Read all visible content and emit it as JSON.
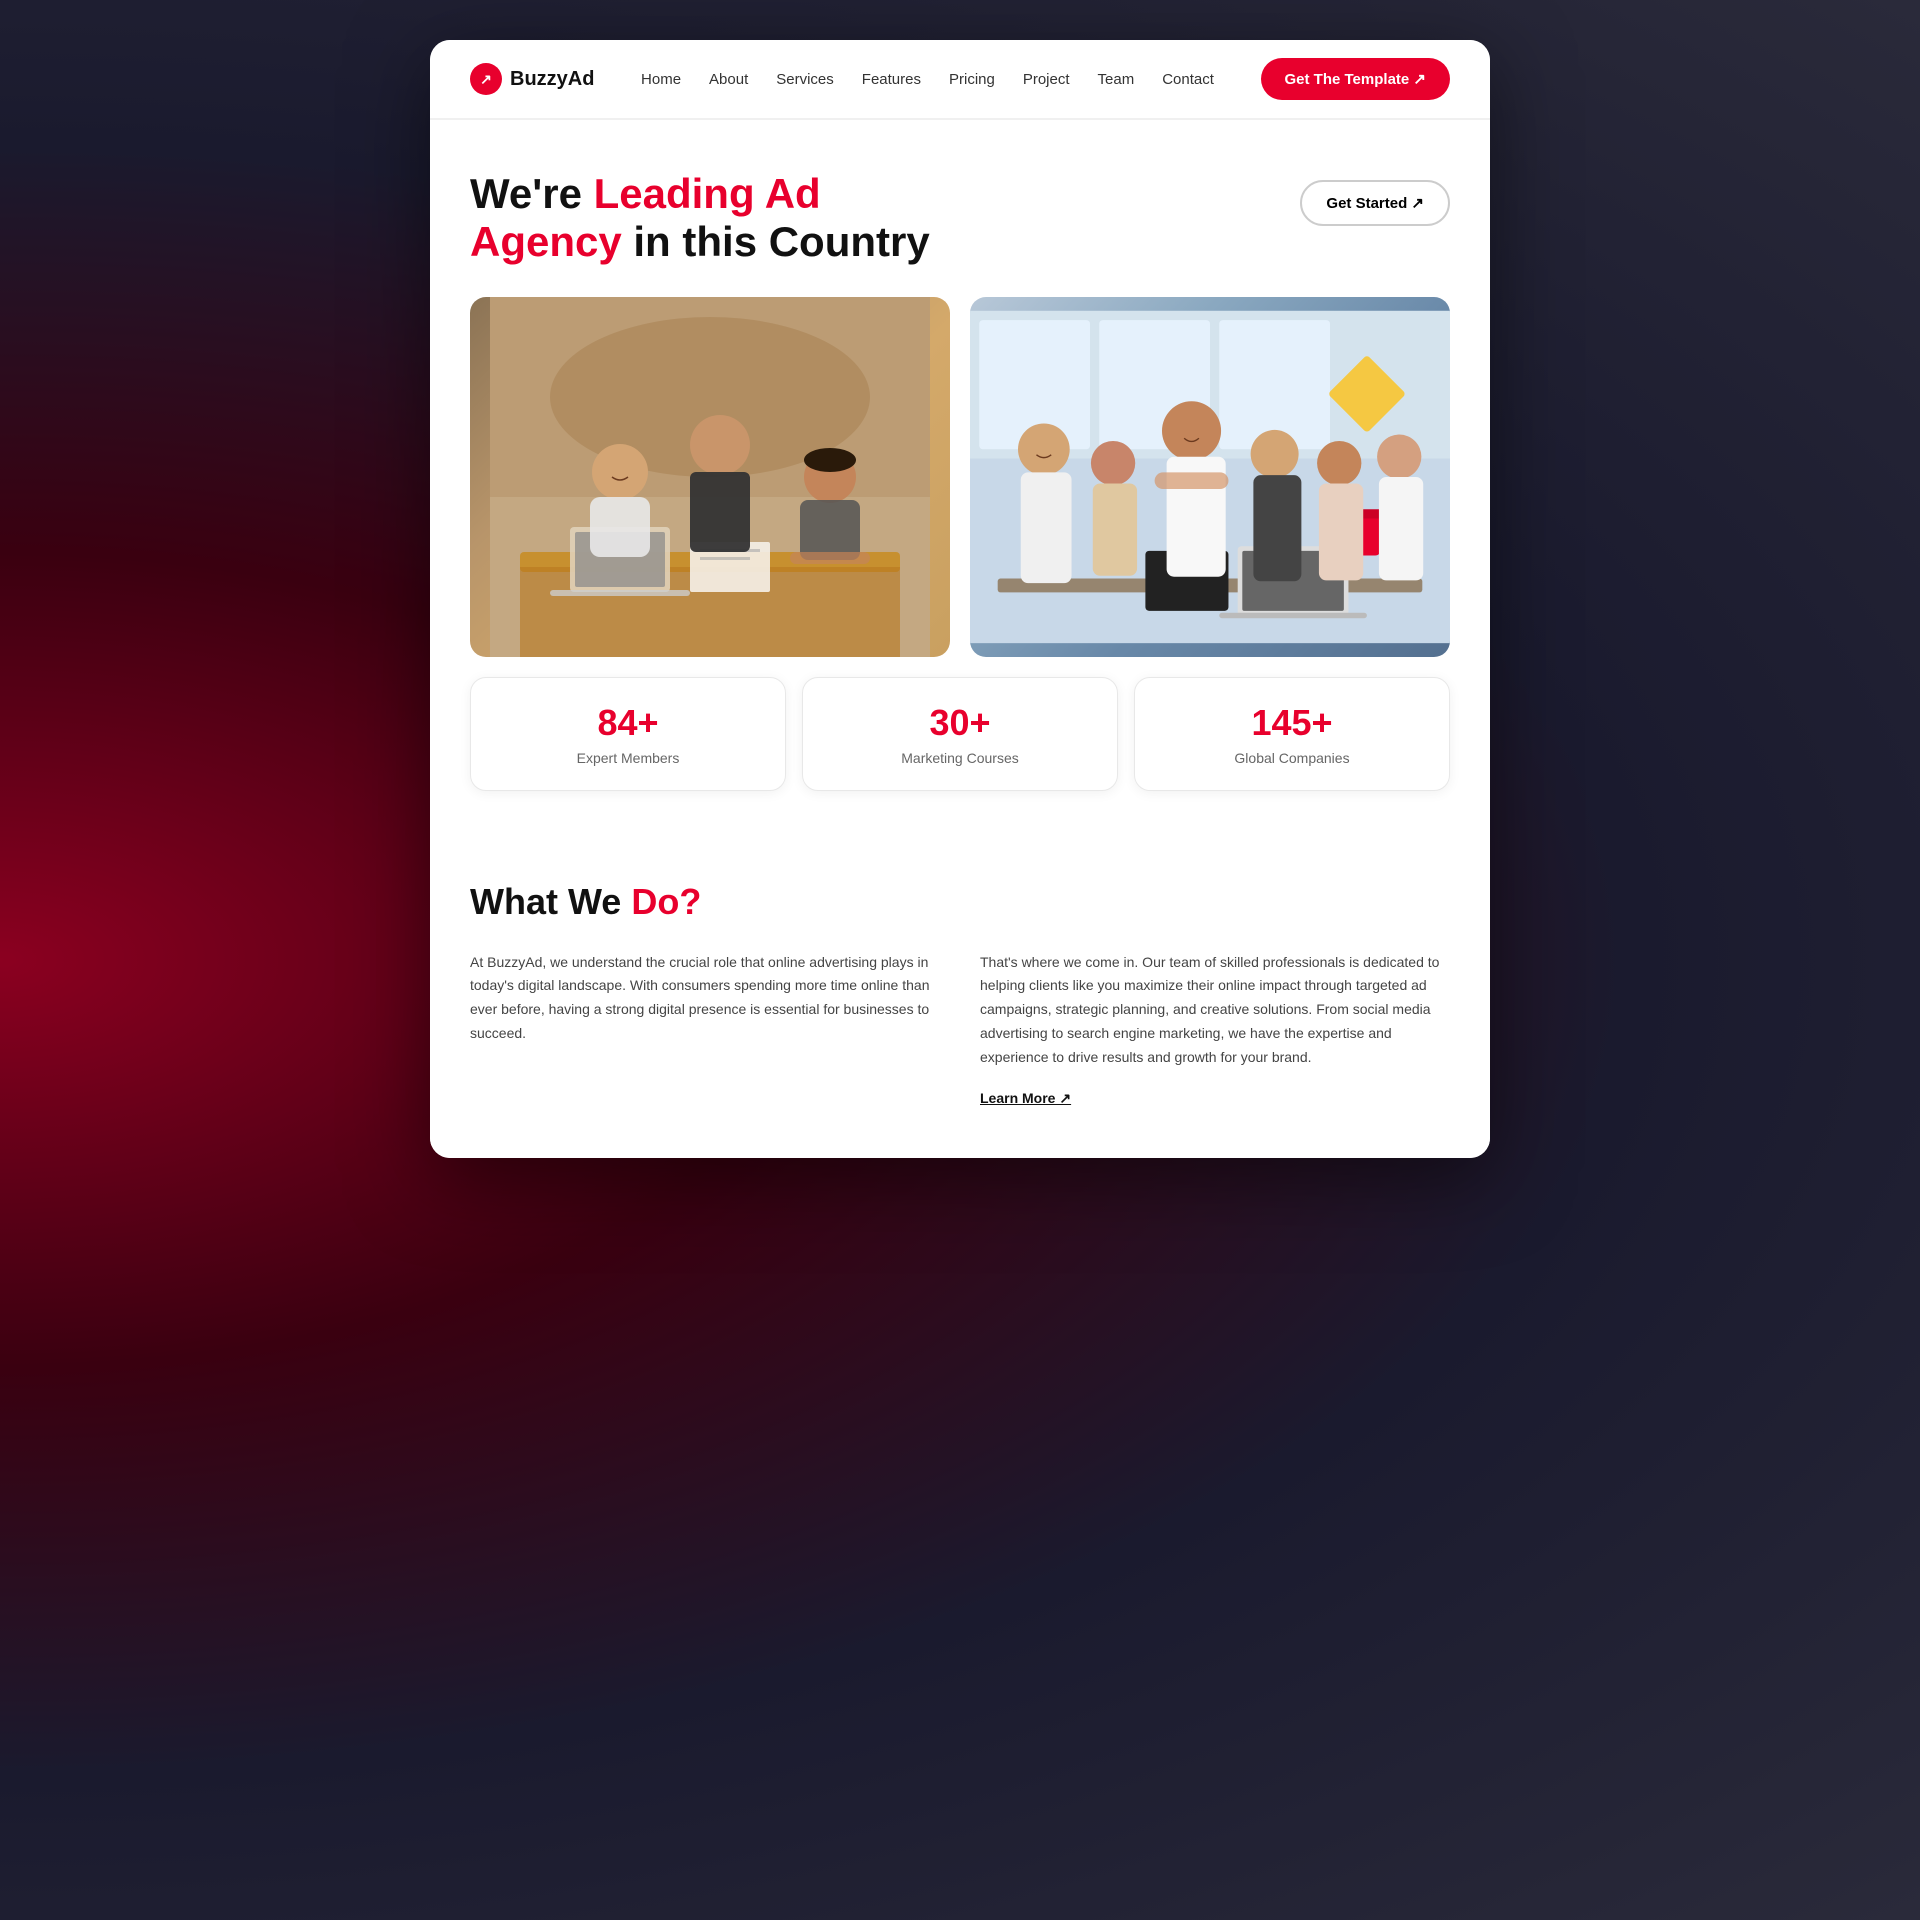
{
  "brand": {
    "name": "BuzzyAd",
    "logo_icon": "↗"
  },
  "nav": {
    "items": [
      {
        "label": "Home",
        "href": "#"
      },
      {
        "label": "About",
        "href": "#"
      },
      {
        "label": "Services",
        "href": "#"
      },
      {
        "label": "Features",
        "href": "#"
      },
      {
        "label": "Pricing",
        "href": "#"
      },
      {
        "label": "Project",
        "href": "#"
      },
      {
        "label": "Team",
        "href": "#"
      },
      {
        "label": "Contact",
        "href": "#"
      }
    ],
    "cta_label": "Get The Template ↗"
  },
  "hero": {
    "title_line1": "We're ",
    "title_accent1": "Leading Ad",
    "title_line2": "Agency",
    "title_plain2": " in this Country",
    "get_started_label": "Get Started ↗"
  },
  "stats": [
    {
      "number": "84+",
      "label": "Expert Members"
    },
    {
      "number": "30+",
      "label": "Marketing Courses"
    },
    {
      "number": "145+",
      "label": "Global Companies"
    }
  ],
  "what_section": {
    "title_plain": "What We ",
    "title_accent": "Do?",
    "col1_text": "At BuzzyAd, we understand the crucial role that online advertising plays in today's digital landscape. With consumers spending more time online than ever before, having a strong digital presence is essential for businesses to succeed.",
    "col2_text": "That's where we come in. Our team of skilled professionals is dedicated to helping clients like you maximize their online impact through targeted ad campaigns, strategic planning, and creative solutions. From social media advertising to search engine marketing, we have the expertise and experience to drive results and growth for your brand.",
    "learn_more_label": "Learn More ↗"
  }
}
